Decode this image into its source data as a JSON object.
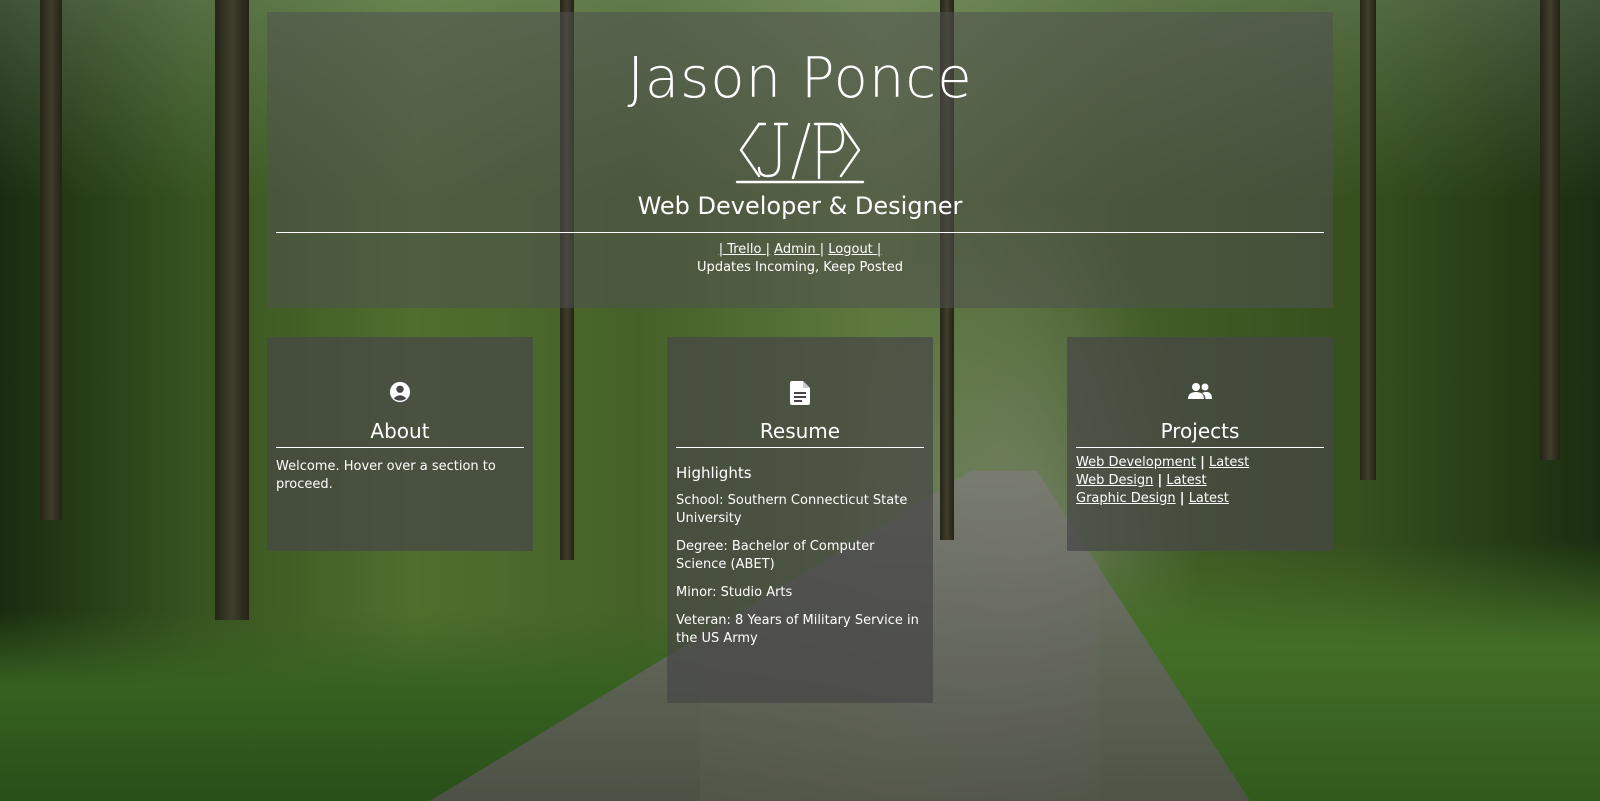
{
  "header": {
    "name": "Jason Ponce",
    "logo_text": "⟨J/P⟩",
    "tagline": "Web Developer & Designer",
    "nav": {
      "pipe": "|",
      "links": [
        "Trello",
        "Admin",
        "Logout"
      ]
    },
    "updates": "Updates Incoming, Keep Posted"
  },
  "about": {
    "icon": "user-circle-icon",
    "title": "About",
    "text": "Welcome. Hover over a section to proceed."
  },
  "resume": {
    "icon": "document-icon",
    "title": "Resume",
    "subtitle": "Highlights",
    "items": [
      "School: Southern Connecticut State University",
      "Degree: Bachelor of Computer Science (ABET)",
      "Minor: Studio Arts",
      "Veteran: 8 Years of Military Service in the US Army"
    ]
  },
  "projects": {
    "icon": "users-icon",
    "title": "Projects",
    "separator": "|",
    "rows": [
      {
        "name": "Web Development",
        "latest": "Latest"
      },
      {
        "name": "Web Design",
        "latest": "Latest"
      },
      {
        "name": "Graphic Design",
        "latest": "Latest"
      }
    ]
  }
}
